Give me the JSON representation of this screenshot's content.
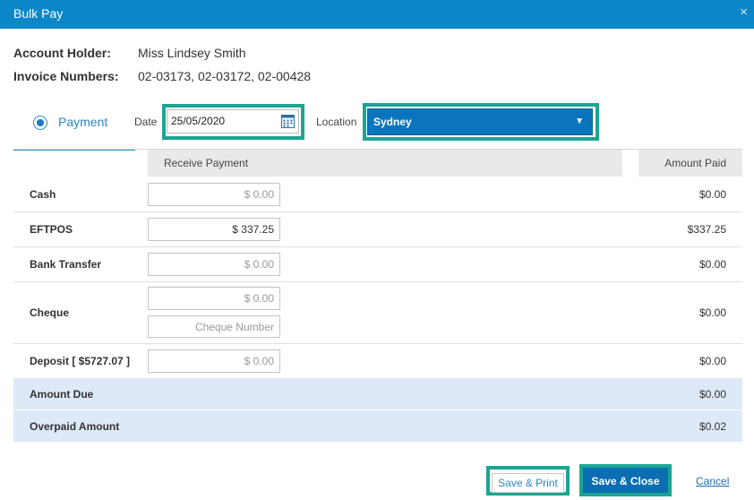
{
  "window": {
    "title": "Bulk Pay",
    "close_glyph": "×"
  },
  "account": {
    "holder_label": "Account Holder:",
    "holder_value": "Miss Lindsey Smith",
    "invoices_label": "Invoice Numbers:",
    "invoices_value": "02-03173, 02-03172, 02-00428"
  },
  "payment_tab": {
    "label": "Payment",
    "selected": true
  },
  "date": {
    "label": "Date",
    "value": "25/05/2020",
    "icon": "calendar-icon"
  },
  "location": {
    "label": "Location",
    "value": "Sydney",
    "icon": "caret-down-icon"
  },
  "table": {
    "receive_header": "Receive Payment",
    "paid_header": "Amount Paid",
    "rows": [
      {
        "name": "Cash",
        "input": "$ 0.00",
        "paid": "$0.00"
      },
      {
        "name": "EFTPOS",
        "input": "$ 337.25",
        "paid": "$337.25"
      },
      {
        "name": "Bank Transfer",
        "input": "$ 0.00",
        "paid": "$0.00"
      },
      {
        "name": "Cheque",
        "input": "$ 0.00",
        "placeholder": "Cheque Number",
        "paid": "$0.00"
      },
      {
        "name": "Deposit  [ $5727.07 ]",
        "input": "$ 0.00",
        "paid": "$0.00"
      }
    ]
  },
  "summary": {
    "amount_due_label": "Amount Due",
    "amount_due": "$0.00",
    "overpaid_label": "Overpaid Amount",
    "overpaid": "$0.02"
  },
  "actions": {
    "save_print": "Save & Print",
    "save_close": "Save & Close",
    "cancel": "Cancel"
  },
  "colors": {
    "title_bar": "#0a86c9",
    "highlight": "#1ba592",
    "summary_bg": "#dde9f7",
    "select_bg": "#0a75bd"
  }
}
